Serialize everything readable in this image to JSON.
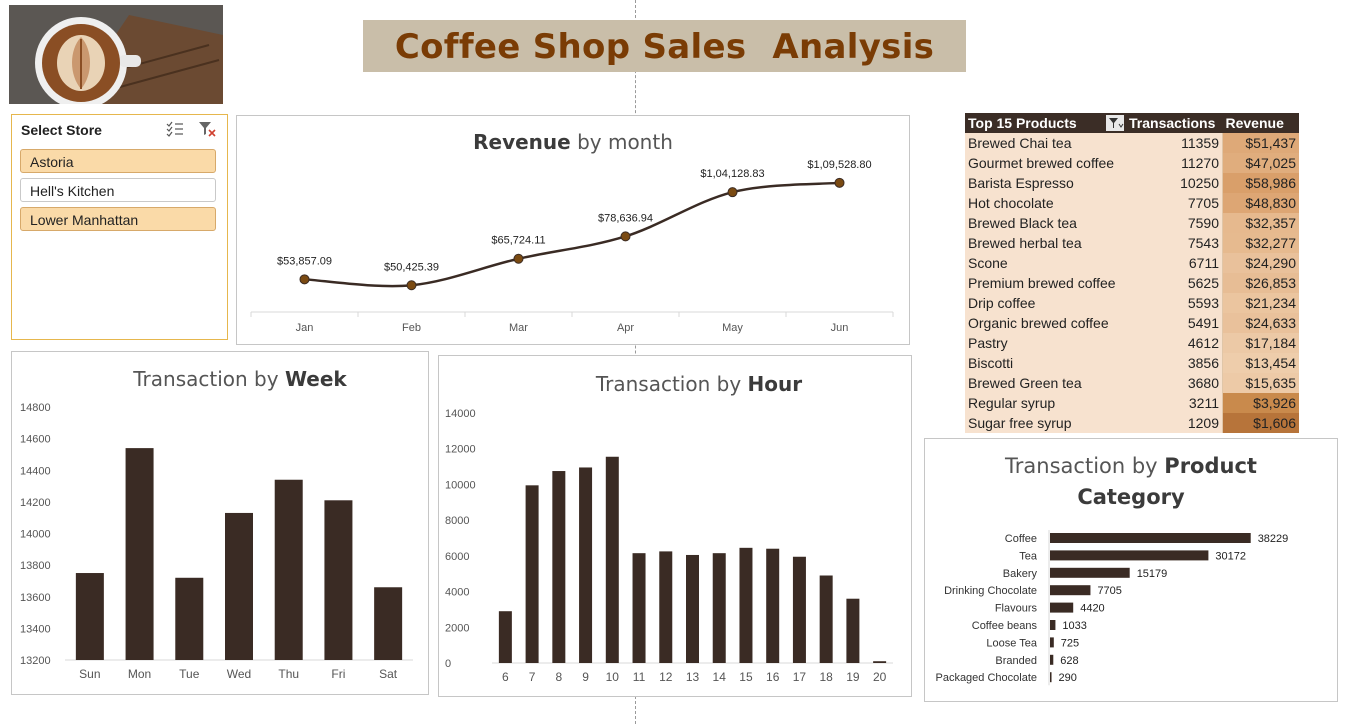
{
  "header": {
    "title_part1": "Coffee Shop Sales",
    "title_part2": "Analysis"
  },
  "slicer": {
    "title": "Select Store",
    "items": [
      {
        "label": "Astoria",
        "selected": true
      },
      {
        "label": "Hell's Kitchen",
        "selected": false
      },
      {
        "label": "Lower Manhattan",
        "selected": true
      }
    ]
  },
  "colors": {
    "bar": "#3a2b24",
    "accent": "#7a3c05",
    "line": "#3a2b24",
    "marker": "#7a4a12"
  },
  "top_products": {
    "headers": [
      "Top 15 Products",
      "Transactions",
      "Revenue"
    ],
    "rows": [
      {
        "name": "Brewed Chai tea",
        "tx": "11359",
        "rev": "$51,437"
      },
      {
        "name": "Gourmet brewed coffee",
        "tx": "11270",
        "rev": "$47,025"
      },
      {
        "name": "Barista Espresso",
        "tx": "10250",
        "rev": "$58,986"
      },
      {
        "name": "Hot chocolate",
        "tx": "7705",
        "rev": "$48,830"
      },
      {
        "name": "Brewed Black tea",
        "tx": "7590",
        "rev": "$32,357"
      },
      {
        "name": "Brewed herbal tea",
        "tx": "7543",
        "rev": "$32,277"
      },
      {
        "name": "Scone",
        "tx": "6711",
        "rev": "$24,290"
      },
      {
        "name": "Premium brewed coffee",
        "tx": "5625",
        "rev": "$26,853"
      },
      {
        "name": "Drip coffee",
        "tx": "5593",
        "rev": "$21,234"
      },
      {
        "name": "Organic brewed coffee",
        "tx": "5491",
        "rev": "$24,633"
      },
      {
        "name": "Pastry",
        "tx": "4612",
        "rev": "$17,184"
      },
      {
        "name": "Biscotti",
        "tx": "3856",
        "rev": "$13,454"
      },
      {
        "name": "Brewed Green tea",
        "tx": "3680",
        "rev": "$15,635"
      },
      {
        "name": "Regular syrup",
        "tx": "3211",
        "rev": "$3,926"
      },
      {
        "name": "Sugar free syrup",
        "tx": "1209",
        "rev": "$1,606"
      }
    ]
  },
  "chart_data": [
    {
      "type": "line",
      "title_bold": "Revenue",
      "title_rest": " by month",
      "categories": [
        "Jan",
        "Feb",
        "Mar",
        "Apr",
        "May",
        "Jun"
      ],
      "values": [
        53857.09,
        50425.39,
        65724.11,
        78636.94,
        104128.83,
        109528.8
      ],
      "labels": [
        "$53,857.09",
        "$50,425.39",
        "$65,724.11",
        "$78,636.94",
        "$1,04,128.83",
        "$1,09,528.80"
      ],
      "ylim": [
        35000,
        125000
      ]
    },
    {
      "type": "bar",
      "title_rest": "Transaction by ",
      "title_bold": "Week",
      "categories": [
        "Sun",
        "Mon",
        "Tue",
        "Wed",
        "Thu",
        "Fri",
        "Sat"
      ],
      "values": [
        13750,
        14540,
        13720,
        14130,
        14340,
        14210,
        13660
      ],
      "ylim": [
        13200,
        14800
      ],
      "yticks": [
        "13200",
        "13400",
        "13600",
        "13800",
        "14000",
        "14200",
        "14400",
        "14600",
        "14800"
      ]
    },
    {
      "type": "bar",
      "title_rest": "Transaction by ",
      "title_bold": "Hour",
      "categories": [
        "6",
        "7",
        "8",
        "9",
        "10",
        "11",
        "12",
        "13",
        "14",
        "15",
        "16",
        "17",
        "18",
        "19",
        "20"
      ],
      "values": [
        2900,
        9950,
        10750,
        10950,
        11550,
        6150,
        6250,
        6050,
        6150,
        6450,
        6400,
        5950,
        4900,
        3600,
        100
      ],
      "ylim": [
        0,
        14000
      ],
      "yticks": [
        "0",
        "2000",
        "4000",
        "6000",
        "8000",
        "10000",
        "12000",
        "14000"
      ]
    },
    {
      "type": "bar",
      "orientation": "horizontal",
      "title_rest": "Transaction by ",
      "title_bold": "Product",
      "title_line2": "Category",
      "categories": [
        "Coffee",
        "Tea",
        "Bakery",
        "Drinking Chocolate",
        "Flavours",
        "Coffee beans",
        "Loose Tea",
        "Branded",
        "Packaged Chocolate"
      ],
      "values": [
        38229,
        30172,
        15179,
        7705,
        4420,
        1033,
        725,
        628,
        290
      ],
      "labels": [
        "38229",
        "30172",
        "15179",
        "7705",
        "4420",
        "1033",
        "725",
        "628",
        "290"
      ],
      "xlim": [
        0,
        40000
      ]
    }
  ]
}
